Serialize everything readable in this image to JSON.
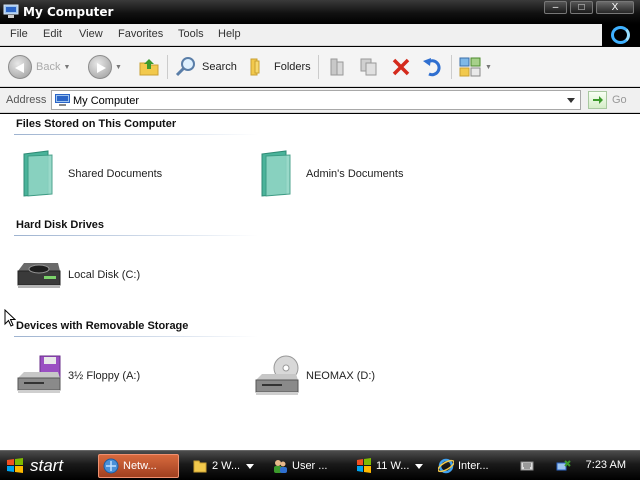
{
  "window": {
    "title": "My Computer",
    "buttons": {
      "minimize": "–",
      "maximize": "□",
      "close": "X"
    }
  },
  "menubar": {
    "items": [
      "File",
      "Edit",
      "View",
      "Favorites",
      "Tools",
      "Help"
    ]
  },
  "toolbar": {
    "back_label": "Back",
    "search_label": "Search",
    "folders_label": "Folders",
    "icons": [
      "back-icon",
      "forward-icon",
      "up-folder-icon",
      "search-icon",
      "folders-icon",
      "move-to-icon",
      "copy-to-icon",
      "delete-icon",
      "undo-icon",
      "views-icon"
    ]
  },
  "address": {
    "label": "Address",
    "value": "My Computer",
    "go_label": "Go"
  },
  "groups": [
    {
      "header": "Files Stored on This Computer",
      "items": [
        {
          "label": "Shared Documents",
          "icon": "folder-icon"
        },
        {
          "label": "Admin's Documents",
          "icon": "folder-icon"
        }
      ]
    },
    {
      "header": "Hard Disk Drives",
      "items": [
        {
          "label": "Local Disk (C:)",
          "icon": "hard-disk-icon"
        }
      ]
    },
    {
      "header": "Devices with Removable Storage",
      "items": [
        {
          "label": "3½ Floppy (A:)",
          "icon": "floppy-drive-icon"
        },
        {
          "label": "NEOMAX (D:)",
          "icon": "cd-drive-icon"
        }
      ]
    }
  ],
  "taskbar": {
    "start_label": "start",
    "tasks": [
      {
        "label": "Netw...",
        "icon": "network-icon",
        "active": true
      },
      {
        "label": "2 W...",
        "icon": "folder-icon",
        "active": false
      },
      {
        "label": "User ...",
        "icon": "users-icon",
        "active": false
      },
      {
        "label": "11 W...",
        "icon": "windows-icon",
        "active": false
      },
      {
        "label": "Inter...",
        "icon": "internet-explorer-icon",
        "active": false
      }
    ],
    "clock": "7:23 AM"
  },
  "colors": {
    "accent": "#3fb1ff",
    "active_task": "#c0532a",
    "group_line": "#9eb3d0"
  }
}
